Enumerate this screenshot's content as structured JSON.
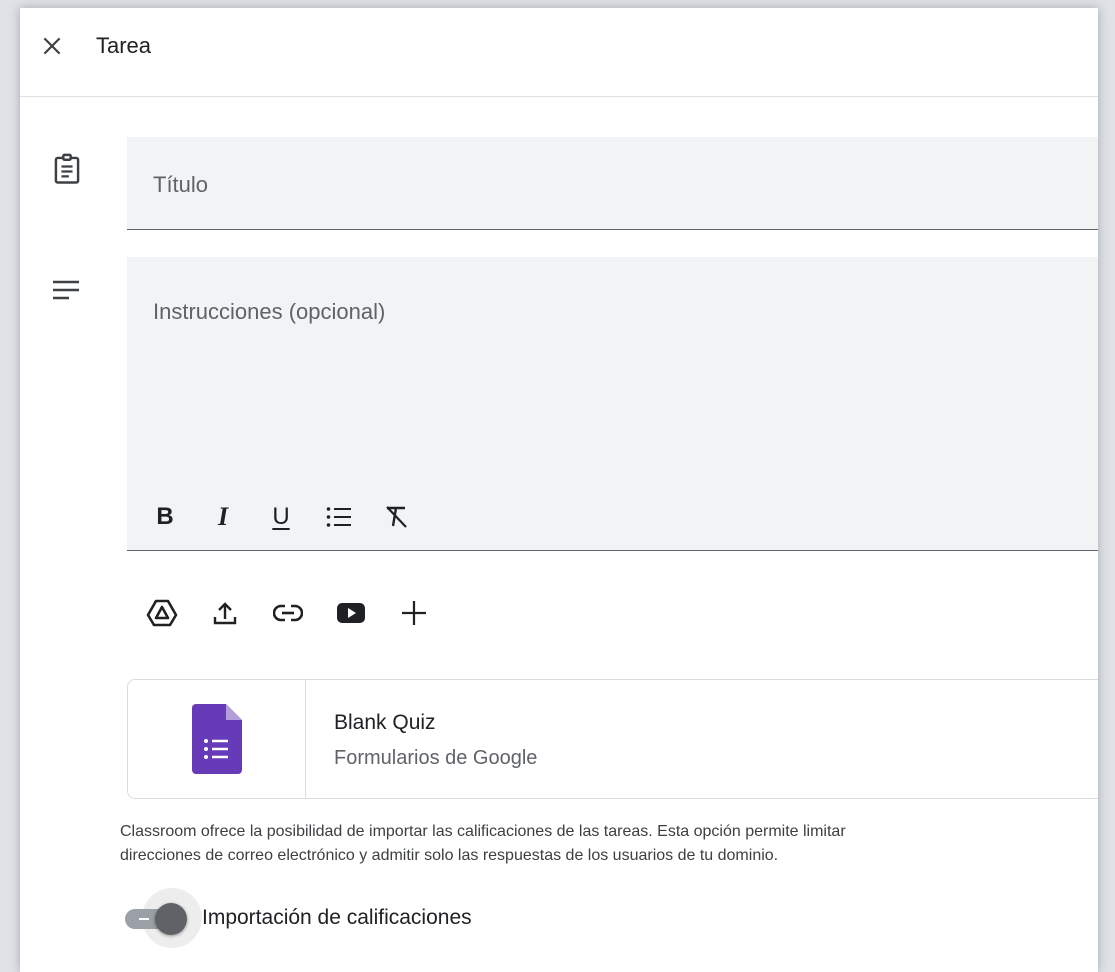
{
  "header": {
    "title": "Tarea"
  },
  "title_field": {
    "placeholder": "Título"
  },
  "instructions_field": {
    "placeholder": "Instrucciones (opcional)"
  },
  "format_toolbar": {
    "bold_label": "B",
    "italic_label": "I",
    "underline_label": "U",
    "items": [
      "bold",
      "italic",
      "underline",
      "bulleted-list",
      "clear-formatting"
    ]
  },
  "attach_toolbar": {
    "items": [
      "google-drive",
      "upload",
      "link",
      "youtube",
      "create"
    ]
  },
  "attachment": {
    "title": "Blank Quiz",
    "subtitle": "Formularios de Google",
    "icon": "google-forms-icon",
    "icon_color": "#673ab7"
  },
  "notice": {
    "line1": "Classroom ofrece la posibilidad de importar las calificaciones de las tareas. Esta opción permite limitar",
    "line2": "direcciones de correo electrónico y admitir solo las respuestas de los usuarios de tu dominio."
  },
  "grade_import": {
    "label": "Importación de calificaciones",
    "enabled": false
  },
  "colors": {
    "field_bg": "#f1f3f4",
    "text_primary": "#202124",
    "text_secondary": "#5f6368",
    "forms_purple": "#673ab7"
  }
}
